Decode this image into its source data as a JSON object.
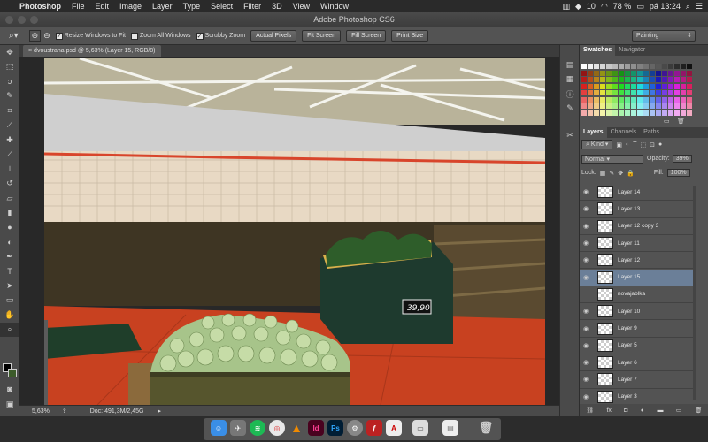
{
  "menubar": {
    "apple_glyph": "",
    "app_name": "Photoshop",
    "items": [
      "File",
      "Edit",
      "Image",
      "Layer",
      "Type",
      "Select",
      "Filter",
      "3D",
      "View",
      "Window"
    ],
    "status_num": "10",
    "battery": "78 %",
    "clock": "pá 13:24"
  },
  "window": {
    "title": "Adobe Photoshop CS6"
  },
  "options": {
    "resize_windows": "Resize Windows to Fit",
    "zoom_all": "Zoom All Windows",
    "scrubby": "Scrubby Zoom",
    "actual_pixels": "Actual Pixels",
    "fit_screen": "Fit Screen",
    "fill_screen": "Fill Screen",
    "print_size": "Print Size",
    "workspace": "Painting"
  },
  "document": {
    "tab_label": "dvoustrana.psd @ 5,63% (Layer 15, RGB/8)",
    "price_tag": "39,90"
  },
  "status": {
    "zoom": "5,63%",
    "doc": "Doc: 491,3M/2,45G"
  },
  "panels": {
    "swatches_tab": "Swatches",
    "navigator_tab": "Navigator",
    "layers_tab": "Layers",
    "channels_tab": "Channels",
    "paths_tab": "Paths",
    "kind": "Kind",
    "blend_mode": "Normal",
    "opacity_label": "Opacity:",
    "opacity_value": "39%",
    "lock_label": "Lock:",
    "fill_label": "Fill:",
    "fill_value": "100%"
  },
  "layers": [
    {
      "name": "Layer 14",
      "visible": true,
      "selected": false
    },
    {
      "name": "Layer 13",
      "visible": true,
      "selected": false
    },
    {
      "name": "Layer 12 copy 3",
      "visible": true,
      "selected": false
    },
    {
      "name": "Layer 11",
      "visible": true,
      "selected": false
    },
    {
      "name": "Layer 12",
      "visible": true,
      "selected": false
    },
    {
      "name": "Layer 15",
      "visible": true,
      "selected": true
    },
    {
      "name": "novajablka",
      "visible": false,
      "selected": false
    },
    {
      "name": "Layer 10",
      "visible": true,
      "selected": false
    },
    {
      "name": "Layer 9",
      "visible": true,
      "selected": false
    },
    {
      "name": "Layer 5",
      "visible": true,
      "selected": false
    },
    {
      "name": "Layer 6",
      "visible": true,
      "selected": false
    },
    {
      "name": "Layer 7",
      "visible": true,
      "selected": false
    },
    {
      "name": "Layer 3",
      "visible": true,
      "selected": false
    }
  ],
  "icons": {
    "tools": [
      "move-icon",
      "marquee-icon",
      "lasso-icon",
      "quick-select-icon",
      "crop-icon",
      "eyedropper-icon",
      "healing-icon",
      "brush-icon",
      "stamp-icon",
      "history-brush-icon",
      "eraser-icon",
      "gradient-icon",
      "blur-icon",
      "dodge-icon",
      "pen-icon",
      "type-icon",
      "path-select-icon",
      "shape-icon",
      "hand-icon",
      "zoom-icon"
    ],
    "dock": [
      "finder",
      "launchpad",
      "spotify",
      "chrome",
      "vlc",
      "indesign",
      "photoshop",
      "preferences",
      "filezilla",
      "acrobat",
      "preview",
      "notes",
      "trash"
    ]
  },
  "colors": {
    "selected_layer": "#6b7f98",
    "panel_bg": "#535353",
    "canvas_bg": "#282828"
  }
}
